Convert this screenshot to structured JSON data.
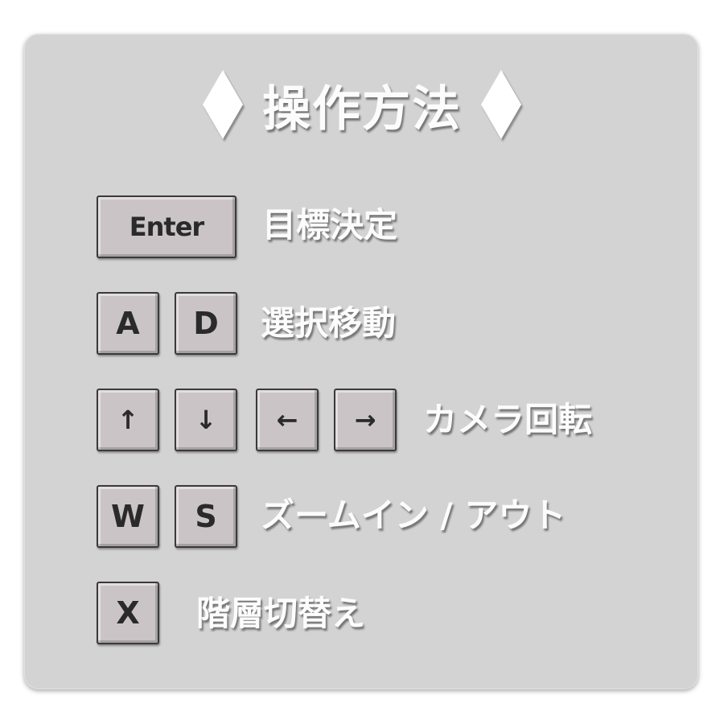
{
  "title": "操作方法",
  "rows": [
    {
      "keys": [
        "Enter"
      ],
      "action": "目標決定"
    },
    {
      "keys": [
        "A",
        "D"
      ],
      "action": "選択移動"
    },
    {
      "keys": [
        "↑",
        "↓",
        "←",
        "→"
      ],
      "action": "カメラ回転"
    },
    {
      "keys": [
        "W",
        "S"
      ],
      "action": "ズームイン / アウト"
    },
    {
      "keys": [
        "X"
      ],
      "action": "階層切替え"
    }
  ],
  "colors": {
    "panel": "#d3d3d3",
    "key_face": "#cbc4c6",
    "key_border": "#3a3a3a",
    "text": "#fcfcfc"
  }
}
